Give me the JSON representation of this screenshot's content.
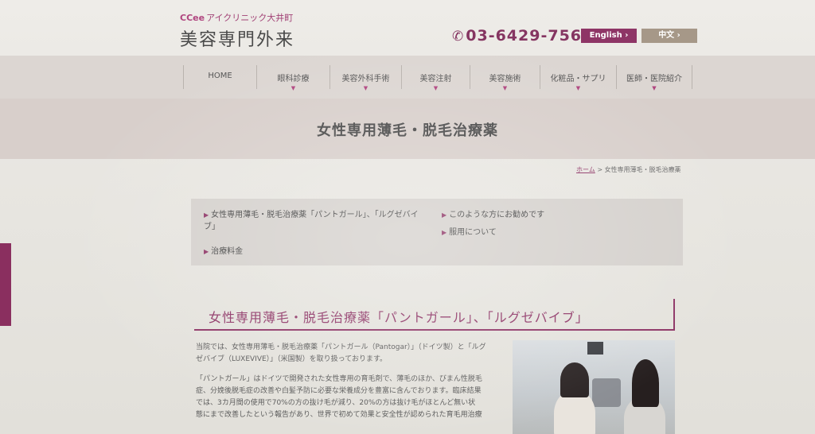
{
  "header": {
    "logo_small_marks": "CCee",
    "logo_small_text": "アイクリニック大井町",
    "logo_main": "美容専門外来",
    "phone_icon": "phone-icon",
    "phone": "03-6429-7567",
    "lang_english": "English ›",
    "lang_chinese": "中文 ›"
  },
  "nav": {
    "items": [
      {
        "label": "HOME"
      },
      {
        "label": "眼科診療"
      },
      {
        "label": "美容外科手術"
      },
      {
        "label": "美容注射"
      },
      {
        "label": "美容施術"
      },
      {
        "label": "化粧品・サプリ"
      },
      {
        "label": "医師・医院紹介"
      }
    ],
    "arrow": "▼"
  },
  "page_title": "女性専用薄毛・脱毛治療薬",
  "breadcrumb": {
    "home": "ホーム",
    "separator": ">",
    "current": "女性専用薄毛・脱毛治療薬"
  },
  "toc": {
    "bullet": "▶",
    "items": [
      {
        "label_line1": "女性専用薄毛・脱毛治療薬「パントガール」、「ルグゼバイ",
        "label_line2": "ブ」"
      },
      {
        "label_line1": "このような方にお勧めです"
      },
      {
        "label_line1": "服用について"
      },
      {
        "label_line1": "治療料金"
      }
    ]
  },
  "section": {
    "title": "女性専用薄毛・脱毛治療薬「パントガール」、「ルグゼバイブ」",
    "para1": [
      "当院では、女性専用薄毛・脱毛治療薬「パントガール（Pantogar）」（ドイツ製）と「ルグ",
      "ゼバイブ（LUXEVIVE）」（米国製）を取り扱っております。"
    ],
    "para2": [
      "「パントガール」はドイツで開発された女性専用の育毛剤で、薄毛のほか、びまん性脱毛",
      "症、分娩後脱毛症の改善や白髪予防に必要な栄養成分を豊富に含んでおります。臨床結果",
      "では、3カ月間の使用で70%の方の抜け毛が減り、20%の方は抜け毛がほとんど無い状",
      "態にまで改善したという報告があり、世界で初めて効果と安全性が認められた育毛用治療"
    ]
  },
  "colors": {
    "accent": "#8e3566",
    "nav_bg": "#dcd6d2",
    "title_band": "#d8cfcb",
    "toc_bg": "#d5d1cd"
  }
}
